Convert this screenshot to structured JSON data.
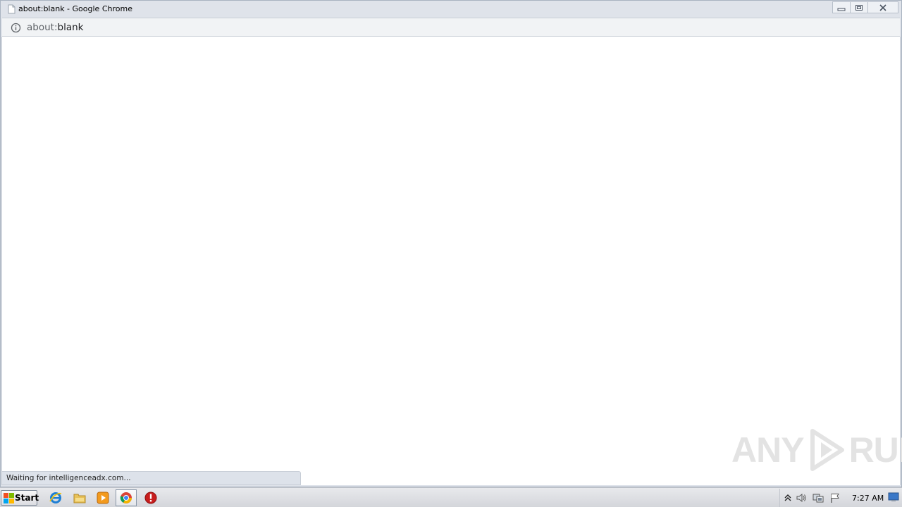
{
  "window": {
    "title": "about:blank - Google Chrome"
  },
  "omnibox": {
    "scheme": "about:",
    "path": "blank"
  },
  "status": {
    "text": "Waiting for intelligenceadx.com..."
  },
  "watermark": {
    "left": "ANY",
    "right": "RUN"
  },
  "taskbar": {
    "start_label": "Start",
    "items": [
      {
        "icon": "internet-explorer-icon"
      },
      {
        "icon": "windows-explorer-icon"
      },
      {
        "icon": "media-player-icon"
      },
      {
        "icon": "chrome-icon",
        "active": true
      },
      {
        "icon": "stop-sign-icon"
      }
    ],
    "tray": {
      "icons": [
        "show-hidden-icons-chevron-icon",
        "volume-icon",
        "network-icon",
        "action-center-flag-icon"
      ],
      "clock": "7:27 AM"
    }
  },
  "colors": {
    "chrome_frame": "#dfe3ea",
    "page_background": "#ffffff",
    "status_bubble": "#dde2ea",
    "taskbar": "#d4d6db"
  }
}
